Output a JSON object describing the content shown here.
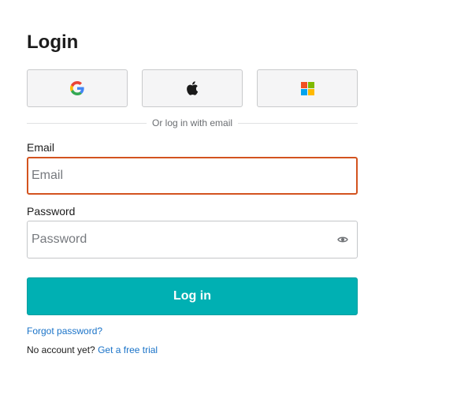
{
  "page_title": "Login",
  "sso": [
    {
      "name": "google",
      "icon": "google-icon"
    },
    {
      "name": "apple",
      "icon": "apple-icon"
    },
    {
      "name": "microsoft",
      "icon": "microsoft-icon"
    }
  ],
  "divider_text": "Or log in with email",
  "email": {
    "label": "Email",
    "placeholder": "Email",
    "value": ""
  },
  "password": {
    "label": "Password",
    "placeholder": "Password",
    "value": "",
    "toggle_icon": "eye-icon"
  },
  "login_button": "Log in",
  "forgot_password": "Forgot password?",
  "signup": {
    "prompt": "No account yet?",
    "link": "Get a free trial"
  },
  "colors": {
    "accent": "#00b0b3",
    "focus_border": "#d3531f",
    "link": "#1a73c8"
  }
}
